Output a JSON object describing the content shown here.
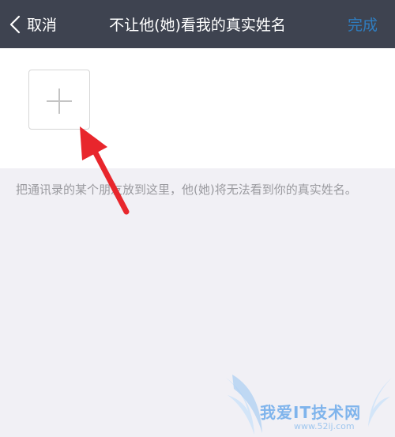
{
  "navbar": {
    "back_label": "取消",
    "title": "不让他(她)看我的真实姓名",
    "done_label": "完成"
  },
  "hint": "把通讯录的某个朋友放到这里，他(她)将无法看到你的真实姓名。",
  "watermark": {
    "title": "我爱IT技术网",
    "url": "www.52ij.com"
  },
  "colors": {
    "navbar_bg": "#3e4350",
    "done_accent": "#2f7dc0",
    "page_bg": "#f1f0f5",
    "arrow": "#e8262c"
  },
  "icons": {
    "back": "chevron-left-icon",
    "add": "plus-icon"
  }
}
